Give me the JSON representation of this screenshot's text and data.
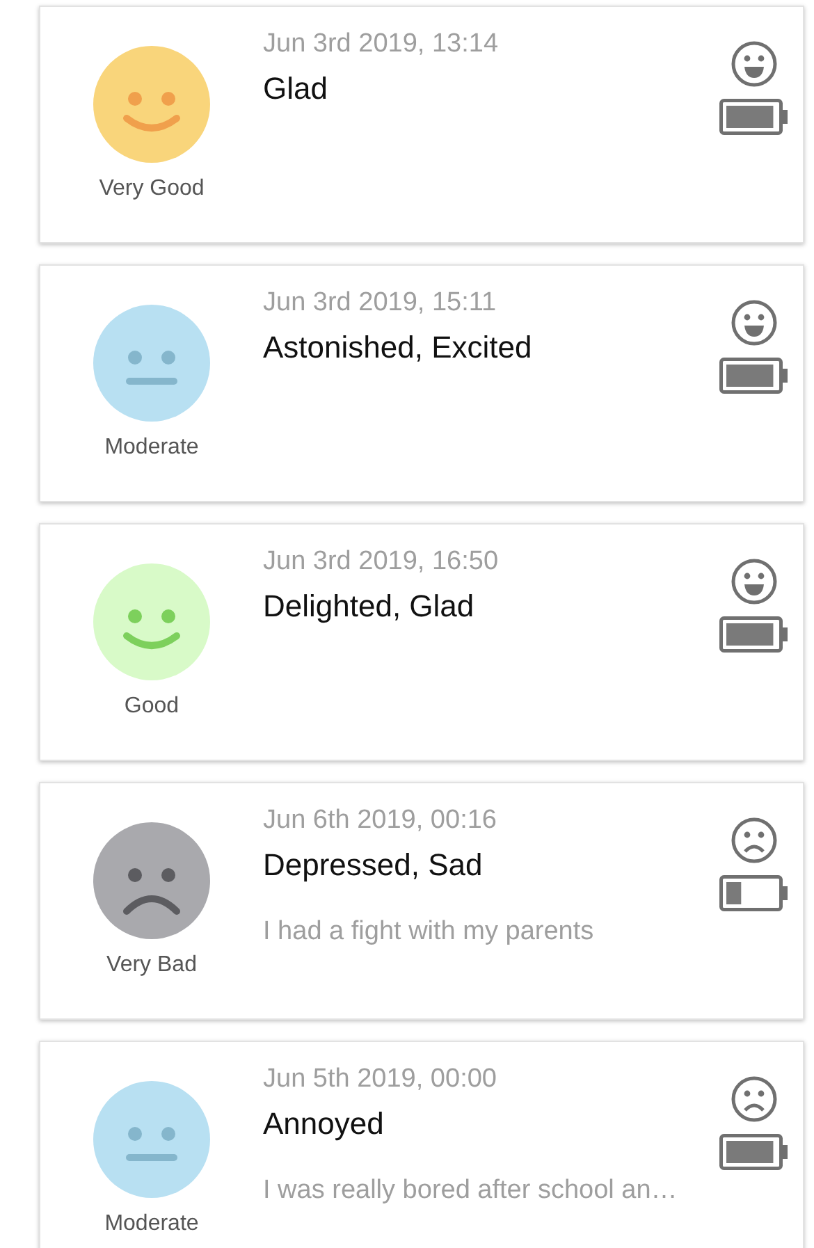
{
  "entries": [
    {
      "mood": {
        "kind": "smile",
        "color": "#f9d57b",
        "label": "Very Good"
      },
      "date": "Jun 3rd 2019, 13:14",
      "emotions": "Glad",
      "mood_icon": {
        "kind": "happy"
      },
      "battery": {
        "level": 0.95
      }
    },
    {
      "mood": {
        "kind": "neutral",
        "color": "#b8e0f2",
        "label": "Moderate"
      },
      "date": "Jun 3rd 2019, 15:11",
      "emotions": "Astonished, Excited",
      "mood_icon": {
        "kind": "happy"
      },
      "battery": {
        "level": 0.95
      }
    },
    {
      "mood": {
        "kind": "smile",
        "color": "#d8fac8",
        "label": "Good"
      },
      "date": "Jun 3rd 2019, 16:50",
      "emotions": "Delighted, Glad",
      "mood_icon": {
        "kind": "happy"
      },
      "battery": {
        "level": 0.95
      }
    },
    {
      "mood": {
        "kind": "frown",
        "color": "#a9a9ad",
        "label": "Very Bad"
      },
      "date": "Jun 6th 2019, 00:16",
      "emotions": "Depressed, Sad",
      "note": "I had a fight with my parents",
      "mood_icon": {
        "kind": "sad"
      },
      "battery": {
        "level": 0.3
      }
    },
    {
      "mood": {
        "kind": "neutral",
        "color": "#b8e0f2",
        "label": "Moderate"
      },
      "date": "Jun 5th 2019, 00:00",
      "emotions": "Annoyed",
      "note": "I was really bored after school an…",
      "mood_icon": {
        "kind": "sad"
      },
      "battery": {
        "level": 0.95
      }
    }
  ]
}
